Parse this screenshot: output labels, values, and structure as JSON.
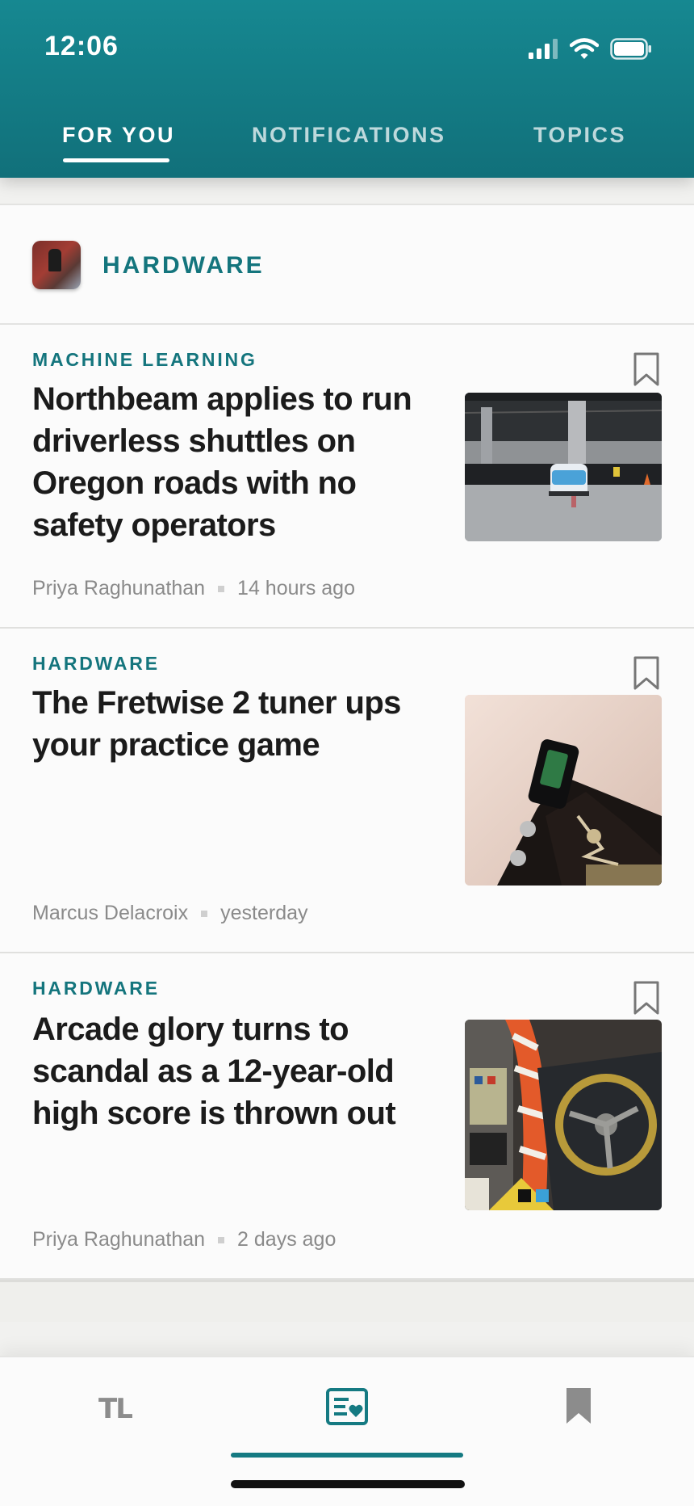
{
  "status_bar": {
    "time": "12:06"
  },
  "tabs": [
    {
      "label": "FOR YOU",
      "active": true
    },
    {
      "label": "NOTIFICATIONS",
      "active": false
    },
    {
      "label": "TOPICS",
      "active": false
    }
  ],
  "topic_header": {
    "name": "HARDWARE"
  },
  "articles": [
    {
      "category": "MACHINE LEARNING",
      "title": "Northbeam applies to run driverless shuttles on Oregon roads with no safety operators",
      "author": "Priya Raghunathan",
      "time": "14 hours ago",
      "image": "shuttle-photo"
    },
    {
      "category": "HARDWARE",
      "title": "The Fretwise 2 tuner ups your practice game",
      "author": "Marcus Delacroix",
      "time": "yesterday",
      "image": "guitar-tuner-photo"
    },
    {
      "category": "HARDWARE",
      "title": "Arcade glory turns to scandal as a 12-year-old high score is thrown out",
      "author": "Priya Raghunathan",
      "time": "2 days ago",
      "image": "arcade-cabinet-photo"
    }
  ],
  "bottom_nav": {
    "items": [
      {
        "label": "TL",
        "icon": "tl-logo"
      },
      {
        "label": "",
        "icon": "feed-heart-icon",
        "active": true
      },
      {
        "label": "",
        "icon": "bookmark-icon"
      }
    ]
  },
  "colors": {
    "brand": "#14757d",
    "header": "#168891",
    "title_text": "#1b1b1b",
    "meta_text": "#8a8a8a"
  }
}
